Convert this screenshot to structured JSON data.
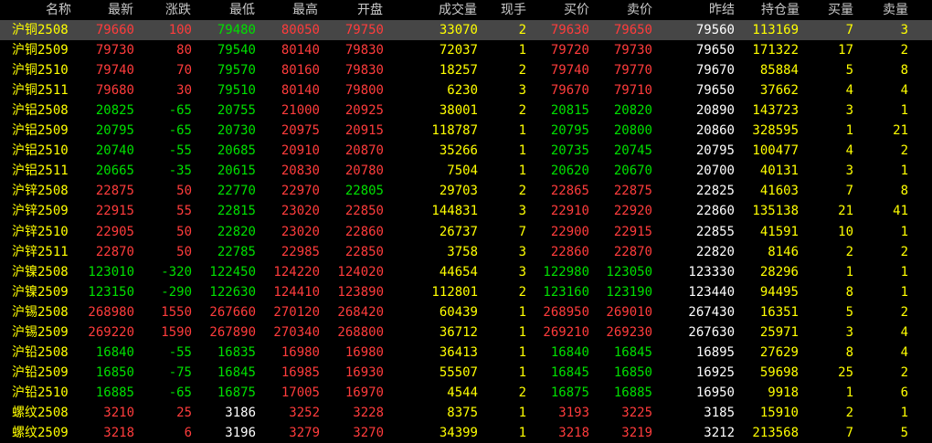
{
  "columns": [
    "名称",
    "最新",
    "涨跌",
    "最低",
    "最高",
    "开盘",
    "成交量",
    "现手",
    "买价",
    "卖价",
    "昨结",
    "持仓量",
    "买量",
    "卖量"
  ],
  "selected_row": 0,
  "colors": {
    "up": "#ff3c3c",
    "down": "#00e000",
    "neutral": "#ffff00",
    "name": "#ffff00",
    "settle": "#ffffff",
    "selected_bg": "#464646"
  },
  "rows": [
    {
      "name": "沪铜2508",
      "latest": "79660",
      "change": "100",
      "low": "79480",
      "high": "80050",
      "open": "79750",
      "volume": "33070",
      "hand": "2",
      "bid": "79630",
      "ask": "79650",
      "prev_settle": "79560",
      "oi": "113169",
      "bid_vol": "7",
      "ask_vol": "3",
      "c": {
        "latest": "red",
        "change": "red",
        "low": "green",
        "high": "red",
        "open": "red",
        "bid": "red",
        "ask": "red"
      }
    },
    {
      "name": "沪铜2509",
      "latest": "79730",
      "change": "80",
      "low": "79540",
      "high": "80140",
      "open": "79830",
      "volume": "72037",
      "hand": "1",
      "bid": "79720",
      "ask": "79730",
      "prev_settle": "79650",
      "oi": "171322",
      "bid_vol": "17",
      "ask_vol": "2",
      "c": {
        "latest": "red",
        "change": "red",
        "low": "green",
        "high": "red",
        "open": "red",
        "bid": "red",
        "ask": "red"
      }
    },
    {
      "name": "沪铜2510",
      "latest": "79740",
      "change": "70",
      "low": "79570",
      "high": "80160",
      "open": "79830",
      "volume": "18257",
      "hand": "2",
      "bid": "79740",
      "ask": "79770",
      "prev_settle": "79670",
      "oi": "85884",
      "bid_vol": "5",
      "ask_vol": "8",
      "c": {
        "latest": "red",
        "change": "red",
        "low": "green",
        "high": "red",
        "open": "red",
        "bid": "red",
        "ask": "red"
      }
    },
    {
      "name": "沪铜2511",
      "latest": "79680",
      "change": "30",
      "low": "79510",
      "high": "80140",
      "open": "79800",
      "volume": "6230",
      "hand": "3",
      "bid": "79670",
      "ask": "79710",
      "prev_settle": "79650",
      "oi": "37662",
      "bid_vol": "4",
      "ask_vol": "4",
      "c": {
        "latest": "red",
        "change": "red",
        "low": "green",
        "high": "red",
        "open": "red",
        "bid": "red",
        "ask": "red"
      }
    },
    {
      "name": "沪铝2508",
      "latest": "20825",
      "change": "-65",
      "low": "20755",
      "high": "21000",
      "open": "20925",
      "volume": "38001",
      "hand": "2",
      "bid": "20815",
      "ask": "20820",
      "prev_settle": "20890",
      "oi": "143723",
      "bid_vol": "3",
      "ask_vol": "1",
      "c": {
        "latest": "green",
        "change": "green",
        "low": "green",
        "high": "red",
        "open": "red",
        "bid": "green",
        "ask": "green"
      }
    },
    {
      "name": "沪铝2509",
      "latest": "20795",
      "change": "-65",
      "low": "20730",
      "high": "20975",
      "open": "20915",
      "volume": "118787",
      "hand": "1",
      "bid": "20795",
      "ask": "20800",
      "prev_settle": "20860",
      "oi": "328595",
      "bid_vol": "1",
      "ask_vol": "21",
      "c": {
        "latest": "green",
        "change": "green",
        "low": "green",
        "high": "red",
        "open": "red",
        "bid": "green",
        "ask": "green"
      }
    },
    {
      "name": "沪铝2510",
      "latest": "20740",
      "change": "-55",
      "low": "20685",
      "high": "20910",
      "open": "20870",
      "volume": "35266",
      "hand": "1",
      "bid": "20735",
      "ask": "20745",
      "prev_settle": "20795",
      "oi": "100477",
      "bid_vol": "4",
      "ask_vol": "2",
      "c": {
        "latest": "green",
        "change": "green",
        "low": "green",
        "high": "red",
        "open": "red",
        "bid": "green",
        "ask": "green"
      }
    },
    {
      "name": "沪铝2511",
      "latest": "20665",
      "change": "-35",
      "low": "20615",
      "high": "20830",
      "open": "20780",
      "volume": "7504",
      "hand": "1",
      "bid": "20620",
      "ask": "20670",
      "prev_settle": "20700",
      "oi": "40131",
      "bid_vol": "3",
      "ask_vol": "1",
      "c": {
        "latest": "green",
        "change": "green",
        "low": "green",
        "high": "red",
        "open": "red",
        "bid": "green",
        "ask": "green"
      }
    },
    {
      "name": "沪锌2508",
      "latest": "22875",
      "change": "50",
      "low": "22770",
      "high": "22970",
      "open": "22805",
      "volume": "29703",
      "hand": "2",
      "bid": "22865",
      "ask": "22875",
      "prev_settle": "22825",
      "oi": "41603",
      "bid_vol": "7",
      "ask_vol": "8",
      "c": {
        "latest": "red",
        "change": "red",
        "low": "green",
        "high": "red",
        "open": "green",
        "bid": "red",
        "ask": "red"
      }
    },
    {
      "name": "沪锌2509",
      "latest": "22915",
      "change": "55",
      "low": "22815",
      "high": "23020",
      "open": "22850",
      "volume": "144831",
      "hand": "3",
      "bid": "22910",
      "ask": "22920",
      "prev_settle": "22860",
      "oi": "135138",
      "bid_vol": "21",
      "ask_vol": "41",
      "c": {
        "latest": "red",
        "change": "red",
        "low": "green",
        "high": "red",
        "open": "red",
        "bid": "red",
        "ask": "red"
      }
    },
    {
      "name": "沪锌2510",
      "latest": "22905",
      "change": "50",
      "low": "22820",
      "high": "23020",
      "open": "22860",
      "volume": "26737",
      "hand": "7",
      "bid": "22900",
      "ask": "22915",
      "prev_settle": "22855",
      "oi": "41591",
      "bid_vol": "10",
      "ask_vol": "1",
      "c": {
        "latest": "red",
        "change": "red",
        "low": "green",
        "high": "red",
        "open": "red",
        "bid": "red",
        "ask": "red"
      }
    },
    {
      "name": "沪锌2511",
      "latest": "22870",
      "change": "50",
      "low": "22785",
      "high": "22985",
      "open": "22850",
      "volume": "3758",
      "hand": "3",
      "bid": "22860",
      "ask": "22870",
      "prev_settle": "22820",
      "oi": "8146",
      "bid_vol": "2",
      "ask_vol": "2",
      "c": {
        "latest": "red",
        "change": "red",
        "low": "green",
        "high": "red",
        "open": "red",
        "bid": "red",
        "ask": "red"
      }
    },
    {
      "name": "沪镍2508",
      "latest": "123010",
      "change": "-320",
      "low": "122450",
      "high": "124220",
      "open": "124020",
      "volume": "44654",
      "hand": "3",
      "bid": "122980",
      "ask": "123050",
      "prev_settle": "123330",
      "oi": "28296",
      "bid_vol": "1",
      "ask_vol": "1",
      "c": {
        "latest": "green",
        "change": "green",
        "low": "green",
        "high": "red",
        "open": "red",
        "bid": "green",
        "ask": "green"
      }
    },
    {
      "name": "沪镍2509",
      "latest": "123150",
      "change": "-290",
      "low": "122630",
      "high": "124410",
      "open": "123890",
      "volume": "112801",
      "hand": "2",
      "bid": "123160",
      "ask": "123190",
      "prev_settle": "123440",
      "oi": "94495",
      "bid_vol": "8",
      "ask_vol": "1",
      "c": {
        "latest": "green",
        "change": "green",
        "low": "green",
        "high": "red",
        "open": "red",
        "bid": "green",
        "ask": "green"
      }
    },
    {
      "name": "沪锡2508",
      "latest": "268980",
      "change": "1550",
      "low": "267660",
      "high": "270120",
      "open": "268420",
      "volume": "60439",
      "hand": "1",
      "bid": "268950",
      "ask": "269010",
      "prev_settle": "267430",
      "oi": "16351",
      "bid_vol": "5",
      "ask_vol": "2",
      "c": {
        "latest": "red",
        "change": "red",
        "low": "red",
        "high": "red",
        "open": "red",
        "bid": "red",
        "ask": "red"
      }
    },
    {
      "name": "沪锡2509",
      "latest": "269220",
      "change": "1590",
      "low": "267890",
      "high": "270340",
      "open": "268800",
      "volume": "36712",
      "hand": "1",
      "bid": "269210",
      "ask": "269230",
      "prev_settle": "267630",
      "oi": "25971",
      "bid_vol": "3",
      "ask_vol": "4",
      "c": {
        "latest": "red",
        "change": "red",
        "low": "red",
        "high": "red",
        "open": "red",
        "bid": "red",
        "ask": "red"
      }
    },
    {
      "name": "沪铅2508",
      "latest": "16840",
      "change": "-55",
      "low": "16835",
      "high": "16980",
      "open": "16980",
      "volume": "36413",
      "hand": "1",
      "bid": "16840",
      "ask": "16845",
      "prev_settle": "16895",
      "oi": "27629",
      "bid_vol": "8",
      "ask_vol": "4",
      "c": {
        "latest": "green",
        "change": "green",
        "low": "green",
        "high": "red",
        "open": "red",
        "bid": "green",
        "ask": "green"
      }
    },
    {
      "name": "沪铅2509",
      "latest": "16850",
      "change": "-75",
      "low": "16845",
      "high": "16985",
      "open": "16930",
      "volume": "55507",
      "hand": "1",
      "bid": "16845",
      "ask": "16850",
      "prev_settle": "16925",
      "oi": "59698",
      "bid_vol": "25",
      "ask_vol": "2",
      "c": {
        "latest": "green",
        "change": "green",
        "low": "green",
        "high": "red",
        "open": "red",
        "bid": "green",
        "ask": "green"
      }
    },
    {
      "name": "沪铅2510",
      "latest": "16885",
      "change": "-65",
      "low": "16875",
      "high": "17005",
      "open": "16970",
      "volume": "4544",
      "hand": "2",
      "bid": "16875",
      "ask": "16885",
      "prev_settle": "16950",
      "oi": "9918",
      "bid_vol": "1",
      "ask_vol": "6",
      "c": {
        "latest": "green",
        "change": "green",
        "low": "green",
        "high": "red",
        "open": "red",
        "bid": "green",
        "ask": "green"
      }
    },
    {
      "name": "螺纹2508",
      "latest": "3210",
      "change": "25",
      "low": "3186",
      "high": "3252",
      "open": "3228",
      "volume": "8375",
      "hand": "1",
      "bid": "3193",
      "ask": "3225",
      "prev_settle": "3185",
      "oi": "15910",
      "bid_vol": "2",
      "ask_vol": "1",
      "c": {
        "latest": "red",
        "change": "red",
        "low": "white",
        "high": "red",
        "open": "red",
        "bid": "red",
        "ask": "red"
      }
    },
    {
      "name": "螺纹2509",
      "latest": "3218",
      "change": "6",
      "low": "3196",
      "high": "3279",
      "open": "3270",
      "volume": "34399",
      "hand": "1",
      "bid": "3218",
      "ask": "3219",
      "prev_settle": "3212",
      "oi": "213568",
      "bid_vol": "7",
      "ask_vol": "5",
      "c": {
        "latest": "red",
        "change": "red",
        "low": "white",
        "high": "red",
        "open": "red",
        "bid": "red",
        "ask": "red"
      }
    }
  ]
}
